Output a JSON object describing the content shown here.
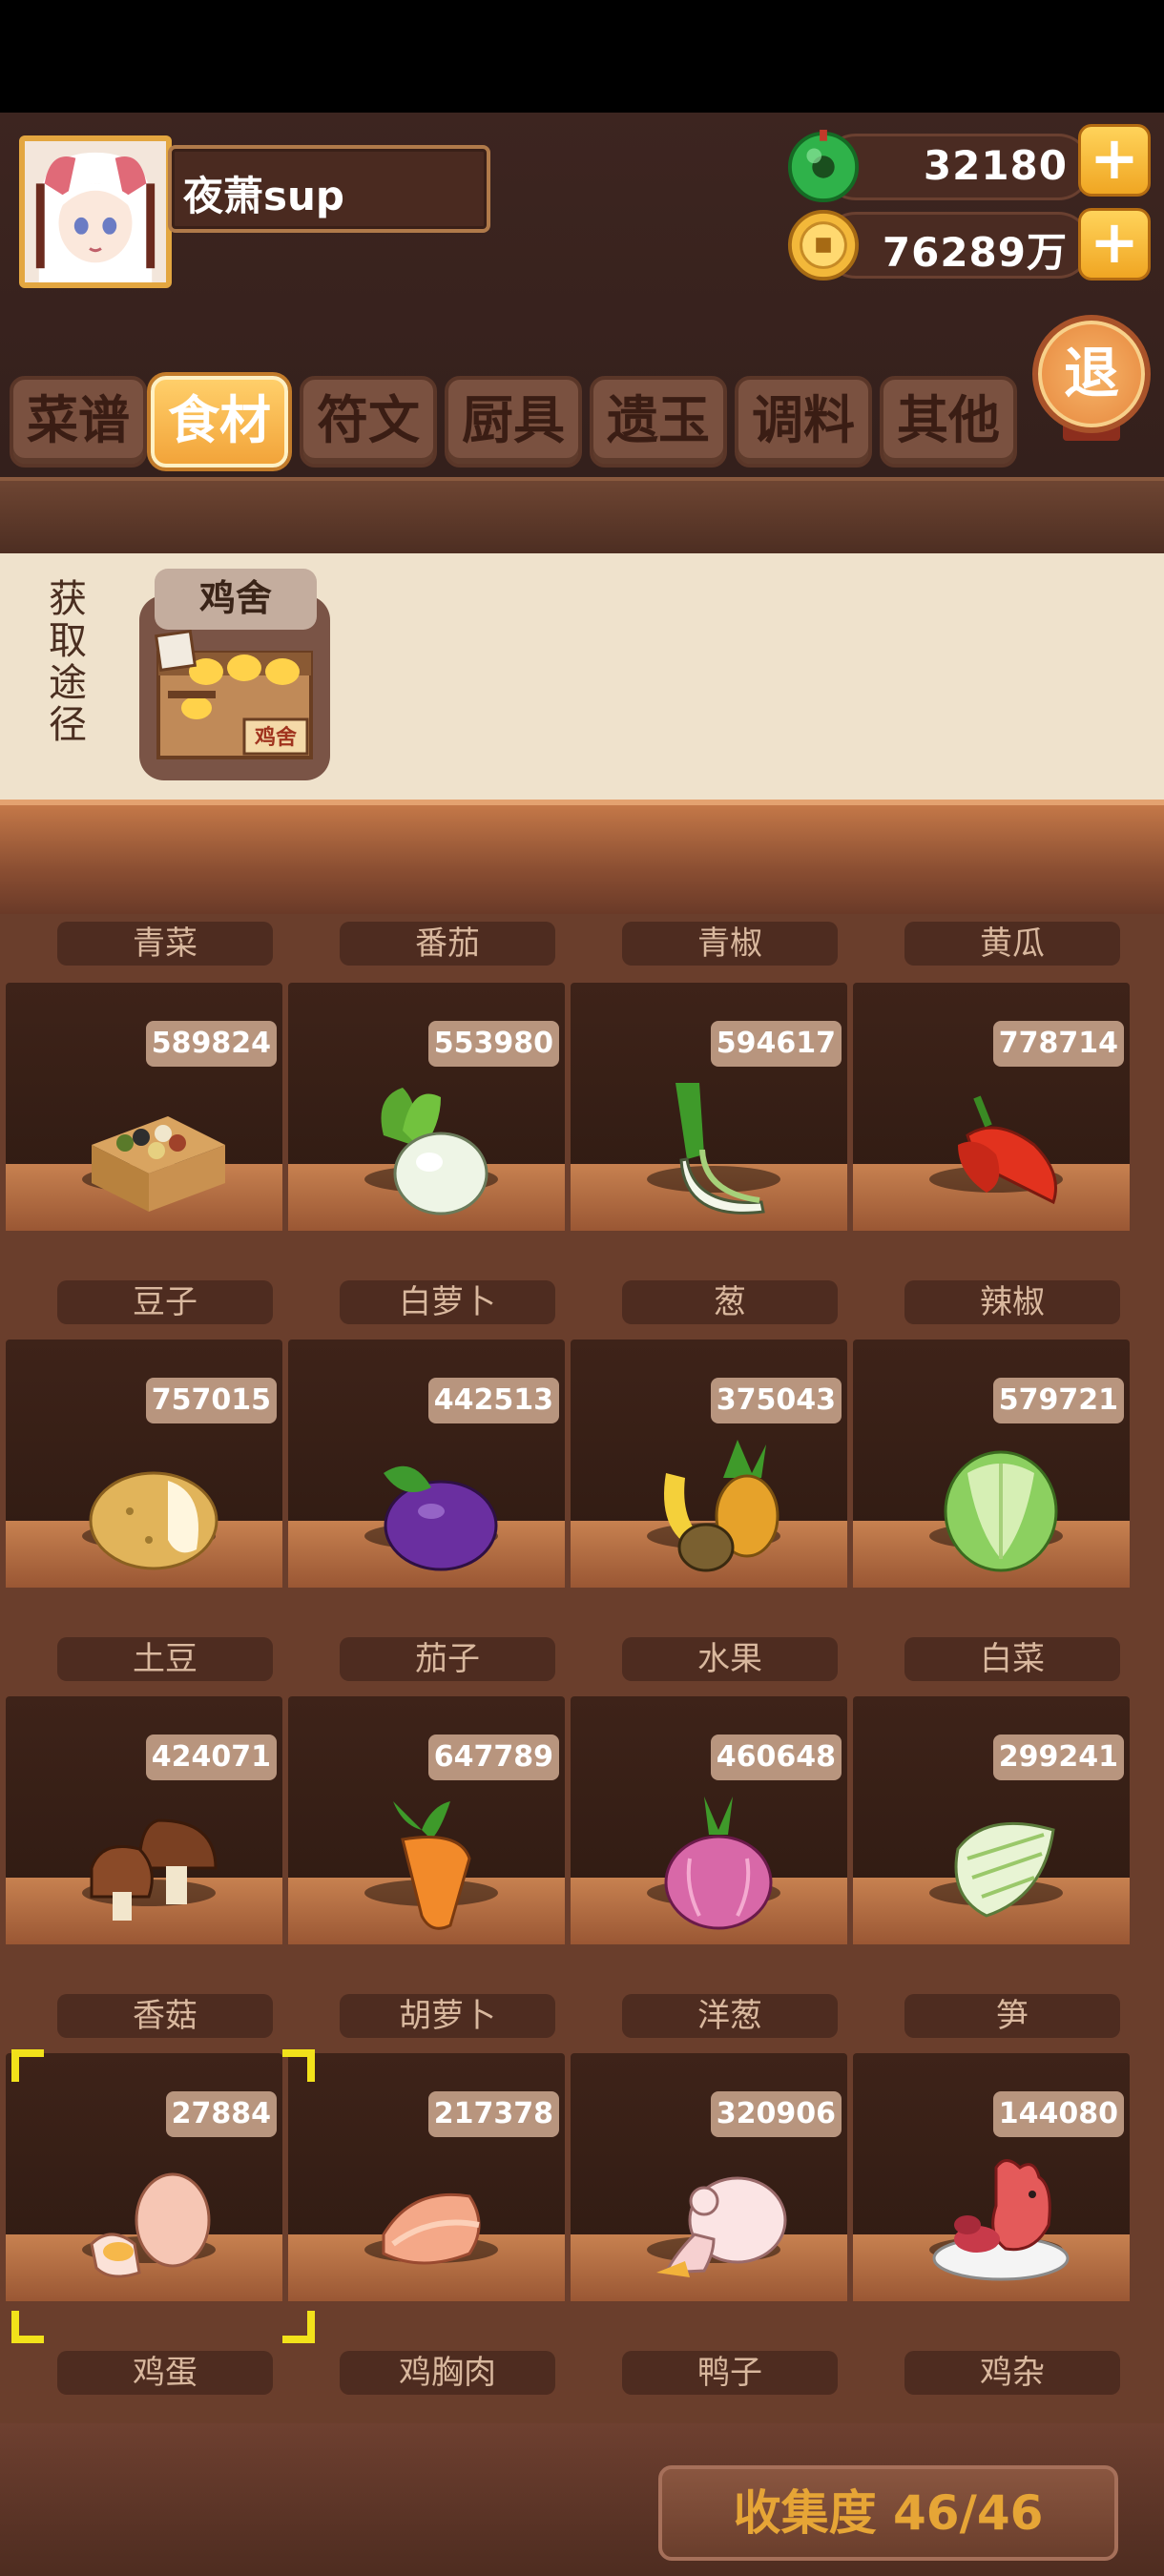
{
  "player": {
    "name": "夜萧sup"
  },
  "currencies": {
    "jade": {
      "value": "32180",
      "icon": "jade-coin-icon",
      "color": "#2fb24a"
    },
    "gold": {
      "value": "76289万",
      "icon": "gold-coin-icon",
      "color": "#f3b83a"
    }
  },
  "exit_label": "退",
  "tabs": [
    {
      "label": "菜谱"
    },
    {
      "label": "食材",
      "active": true
    },
    {
      "label": "符文"
    },
    {
      "label": "厨具"
    },
    {
      "label": "遗玉"
    },
    {
      "label": "调料"
    },
    {
      "label": "其他"
    }
  ],
  "source": {
    "title": "获取途径",
    "building": "鸡舍",
    "building_sign": "鸡舍"
  },
  "top_row_labels": [
    "青菜",
    "番茄",
    "青椒",
    "黄瓜"
  ],
  "items": [
    {
      "name": "豆子",
      "count": "589824",
      "icon": "beans-box-icon"
    },
    {
      "name": "白萝卜",
      "count": "553980",
      "icon": "white-radish-icon"
    },
    {
      "name": "葱",
      "count": "594617",
      "icon": "scallion-icon"
    },
    {
      "name": "辣椒",
      "count": "778714",
      "icon": "chili-icon"
    },
    {
      "name": "土豆",
      "count": "757015",
      "icon": "potato-icon"
    },
    {
      "name": "茄子",
      "count": "442513",
      "icon": "eggplant-icon"
    },
    {
      "name": "水果",
      "count": "375043",
      "icon": "fruit-icon"
    },
    {
      "name": "白菜",
      "count": "579721",
      "icon": "cabbage-icon"
    },
    {
      "name": "香菇",
      "count": "424071",
      "icon": "mushroom-icon"
    },
    {
      "name": "胡萝卜",
      "count": "647789",
      "icon": "carrot-icon"
    },
    {
      "name": "洋葱",
      "count": "460648",
      "icon": "onion-icon"
    },
    {
      "name": "笋",
      "count": "299241",
      "icon": "bamboo-shoot-icon"
    },
    {
      "name": "鸡蛋",
      "count": "27884",
      "icon": "egg-icon",
      "selected": true
    },
    {
      "name": "鸡胸肉",
      "count": "217378",
      "icon": "chicken-breast-icon"
    },
    {
      "name": "鸭子",
      "count": "320906",
      "icon": "duck-icon"
    },
    {
      "name": "鸡杂",
      "count": "144080",
      "icon": "chicken-offal-icon"
    }
  ],
  "collection": {
    "text": "收集度 46/46"
  }
}
